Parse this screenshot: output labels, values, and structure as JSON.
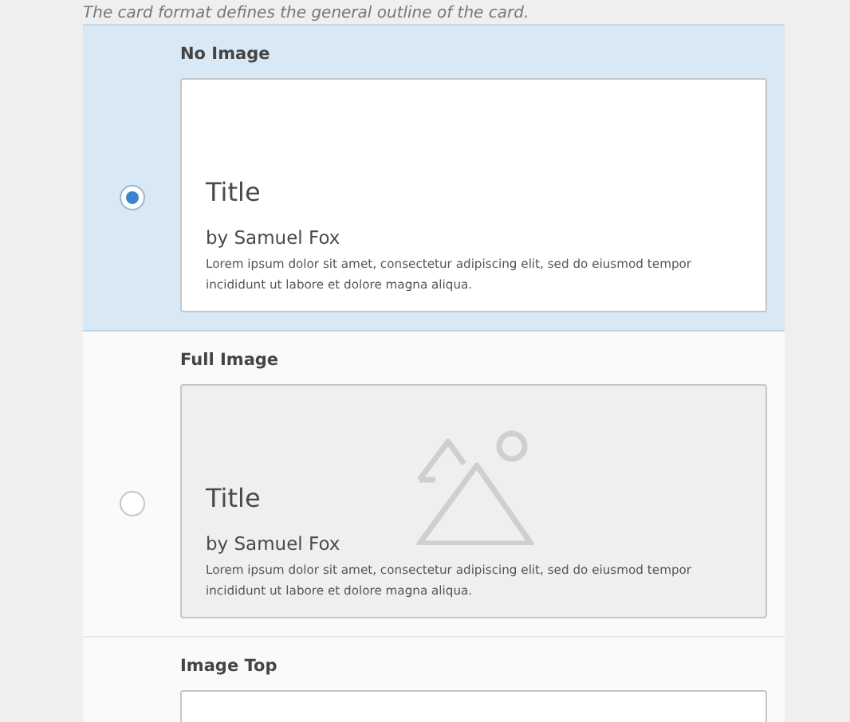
{
  "hint": "The card format defines the general outline of the card.",
  "options": [
    {
      "label": "No Image",
      "selected": true,
      "kind": "no-image",
      "card": {
        "title": "Title",
        "byline": "by Samuel Fox",
        "body": "Lorem ipsum dolor sit amet, consectetur adipiscing elit, sed do eiusmod tempor incididunt ut labore et dolore magna aliqua."
      }
    },
    {
      "label": "Full Image",
      "selected": false,
      "kind": "full-image",
      "card": {
        "title": "Title",
        "byline": "by Samuel Fox",
        "body": "Lorem ipsum dolor sit amet, consectetur adipiscing elit, sed do eiusmod tempor incididunt ut labore et dolore magna aliqua."
      }
    },
    {
      "label": "Image Top",
      "selected": false,
      "kind": "image-top"
    }
  ]
}
